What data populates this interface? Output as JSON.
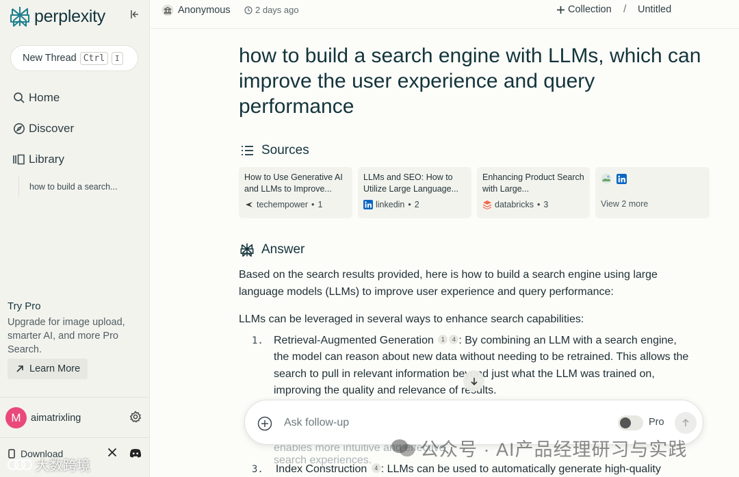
{
  "sidebar": {
    "brand": "perplexity",
    "new_thread": {
      "label": "New Thread",
      "key1": "Ctrl",
      "key2": "I"
    },
    "nav": [
      {
        "label": "Home",
        "icon": "search-icon"
      },
      {
        "label": "Discover",
        "icon": "compass-icon"
      },
      {
        "label": "Library",
        "icon": "library-icon"
      }
    ],
    "library_items": [
      "how to build a search..."
    ],
    "try_pro": {
      "title": "Try Pro",
      "description": "Upgrade for image upload, smarter AI, and more Pro Search.",
      "button": "Learn More"
    },
    "user": {
      "initial": "M",
      "name": "aimatrixling",
      "avatar_color": "#e9497b"
    },
    "download": "Download"
  },
  "header": {
    "author": "Anonymous",
    "time": "2 days ago",
    "collection": "Collection",
    "separator": "/",
    "title": "Untitled"
  },
  "thread": {
    "question": "how to build a search engine with LLMs, which can improve the user experience and query performance",
    "sources_heading": "Sources",
    "sources": [
      {
        "title": "How to Use Generative AI and LLMs to Improve...",
        "site": "techempower",
        "index": "1"
      },
      {
        "title": "LLMs and SEO: How to Utilize Large Language...",
        "site": "linkedin",
        "index": "2"
      },
      {
        "title": "Enhancing Product Search with Large...",
        "site": "databricks",
        "index": "3"
      }
    ],
    "more_sources": "View 2 more",
    "answer_heading": "Answer",
    "answer_intro": "Based on the search results provided, here is how to build a search engine using large language models (LLMs) to improve user experience and query performance:",
    "answer_lead": "LLMs can be leveraged in several ways to enhance search capabilities:",
    "item1": {
      "num": "1.",
      "title": "Retrieval-Augmented Generation",
      "cite_a": "1",
      "cite_b": "4",
      "text": ": By combining an LLM with a search engine, the model can reason about new data without needing to be retrained. This allows the search to pull in relevant information beyond just what the LLM was trained on, improving the quality and relevance of results."
    },
    "peek_line": "enables more intuitive and effective search experiences.",
    "item3": {
      "num": "3.",
      "title": "Index Construction",
      "cite": "4",
      "text": ": LLMs can be used to automatically generate high-quality"
    }
  },
  "composer": {
    "placeholder": "Ask follow-up",
    "pro_label": "Pro"
  },
  "watermark": {
    "text": "公众号 · AI产品经理研习与实践",
    "corner": "大数跨境"
  },
  "colors": {
    "accent": "#20808d",
    "sidebar_bg": "#f3f3ee",
    "page_bg": "#fcfcf9"
  }
}
